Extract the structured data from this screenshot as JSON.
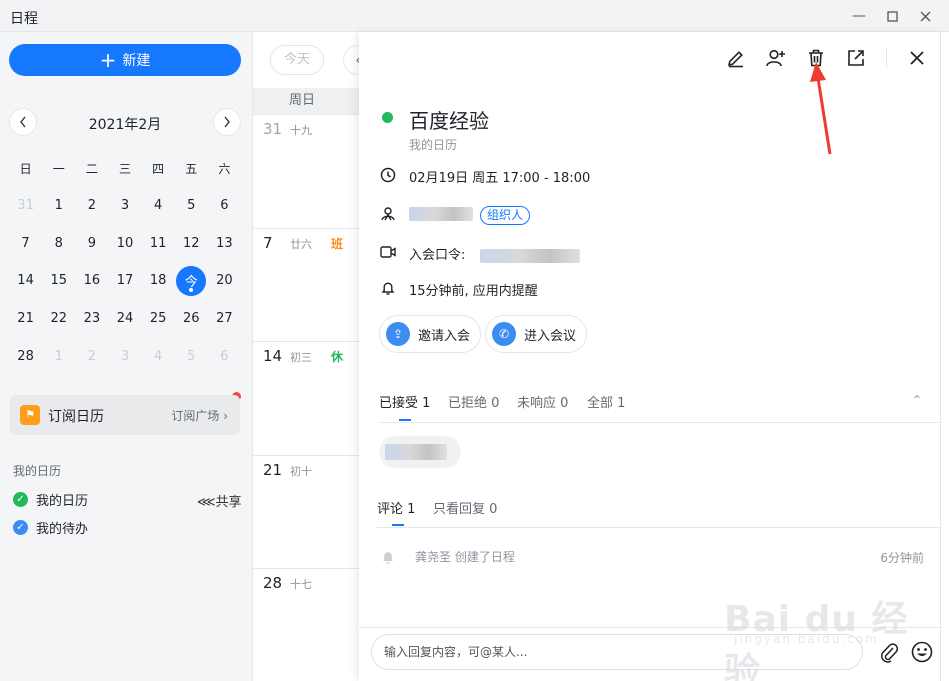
{
  "window": {
    "title": "日程"
  },
  "sidebar": {
    "new_label": "新建",
    "month_label": "2021年2月",
    "weekdays": [
      "日",
      "一",
      "二",
      "三",
      "四",
      "五",
      "六"
    ],
    "today_label": "今",
    "days": [
      "31",
      "1",
      "2",
      "3",
      "4",
      "5",
      "6",
      "7",
      "8",
      "9",
      "10",
      "11",
      "12",
      "13",
      "14",
      "15",
      "16",
      "17",
      "18",
      "19",
      "20",
      "21",
      "22",
      "23",
      "24",
      "25",
      "26",
      "27",
      "28",
      "1",
      "2",
      "3",
      "4",
      "5",
      "6"
    ],
    "subscribe": {
      "label": "订阅日历",
      "square": "订阅广场",
      "icon": "bookmark-icon"
    },
    "my_calendars_title": "我的日历",
    "calendars": [
      {
        "name": "我的日历",
        "color": "#22b85c"
      },
      {
        "name": "我的待办",
        "color": "#3c8cf2"
      }
    ],
    "share_label": "共享"
  },
  "week_view": {
    "today_button": "今天",
    "column_header": "周日",
    "cells": [
      {
        "day": "31",
        "lunar": "十九",
        "tag": "",
        "tag_color": ""
      },
      {
        "day": "7",
        "lunar": "廿六",
        "tag": "班",
        "tag_color": "#ff8a1f"
      },
      {
        "day": "14",
        "lunar": "初三",
        "tag": "休",
        "tag_color": "#22b85c"
      },
      {
        "day": "21",
        "lunar": "初十",
        "tag": "",
        "tag_color": ""
      },
      {
        "day": "28",
        "lunar": "十七",
        "tag": "",
        "tag_color": ""
      }
    ]
  },
  "detail": {
    "title": "百度经验",
    "calendar": "我的日历",
    "color": "#22b85c",
    "time": "02月19日 周五 17:00 - 18:00",
    "organizer_tag": "组织人",
    "meeting_code_label": "入会口令:",
    "reminder": "15分钟前, 应用内提醒",
    "invite_button": "邀请入会",
    "join_button": "进入会议",
    "tabs": {
      "accepted": "已接受 1",
      "declined": "已拒绝 0",
      "no_response": "未响应 0",
      "all": "全部 1"
    },
    "comment_tabs": {
      "comments": "评论 1",
      "replies_only": "只看回复 0"
    },
    "log_text": "龚尧圣 创建了日程",
    "log_time": "6分钟前"
  },
  "reply": {
    "placeholder": "输入回复内容，可@某人..."
  },
  "watermark": {
    "main": "Bai du 经验",
    "sub": "jingyan.baidu.com"
  },
  "colors": {
    "accent": "#1677ff",
    "annotation_arrow": "#f03b30"
  }
}
